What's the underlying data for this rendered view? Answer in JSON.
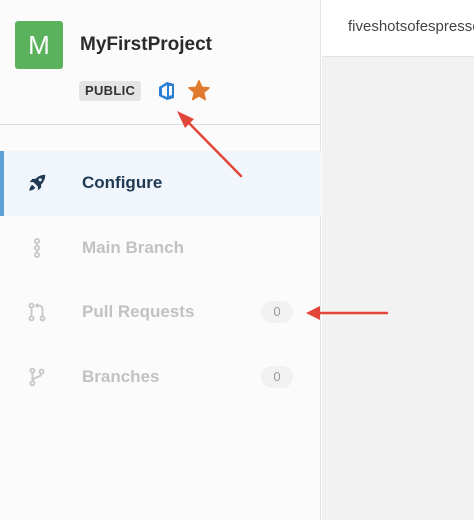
{
  "project": {
    "avatar_letter": "M",
    "name": "MyFirstProject",
    "visibility_badge": "PUBLIC",
    "service_icon": "azure-devops-icon",
    "favorite_icon": "star-icon"
  },
  "nav": {
    "items": [
      {
        "label": "Configure",
        "icon": "rocket-icon",
        "active": true
      },
      {
        "label": "Main Branch",
        "icon": "commit-line-icon"
      },
      {
        "label": "Pull Requests",
        "icon": "pull-request-icon",
        "count": "0"
      },
      {
        "label": "Branches",
        "icon": "branch-icon",
        "count": "0"
      }
    ]
  },
  "topbar": {
    "text": "fiveshotsofespresso"
  },
  "colors": {
    "avatar": "#5bb25c",
    "active_indicator": "#5f9fd8",
    "active_label": "#1f3a52",
    "star": "#e07b2f",
    "service_icon": "#2a7fd4",
    "annotation_arrow": "#e2463a"
  }
}
